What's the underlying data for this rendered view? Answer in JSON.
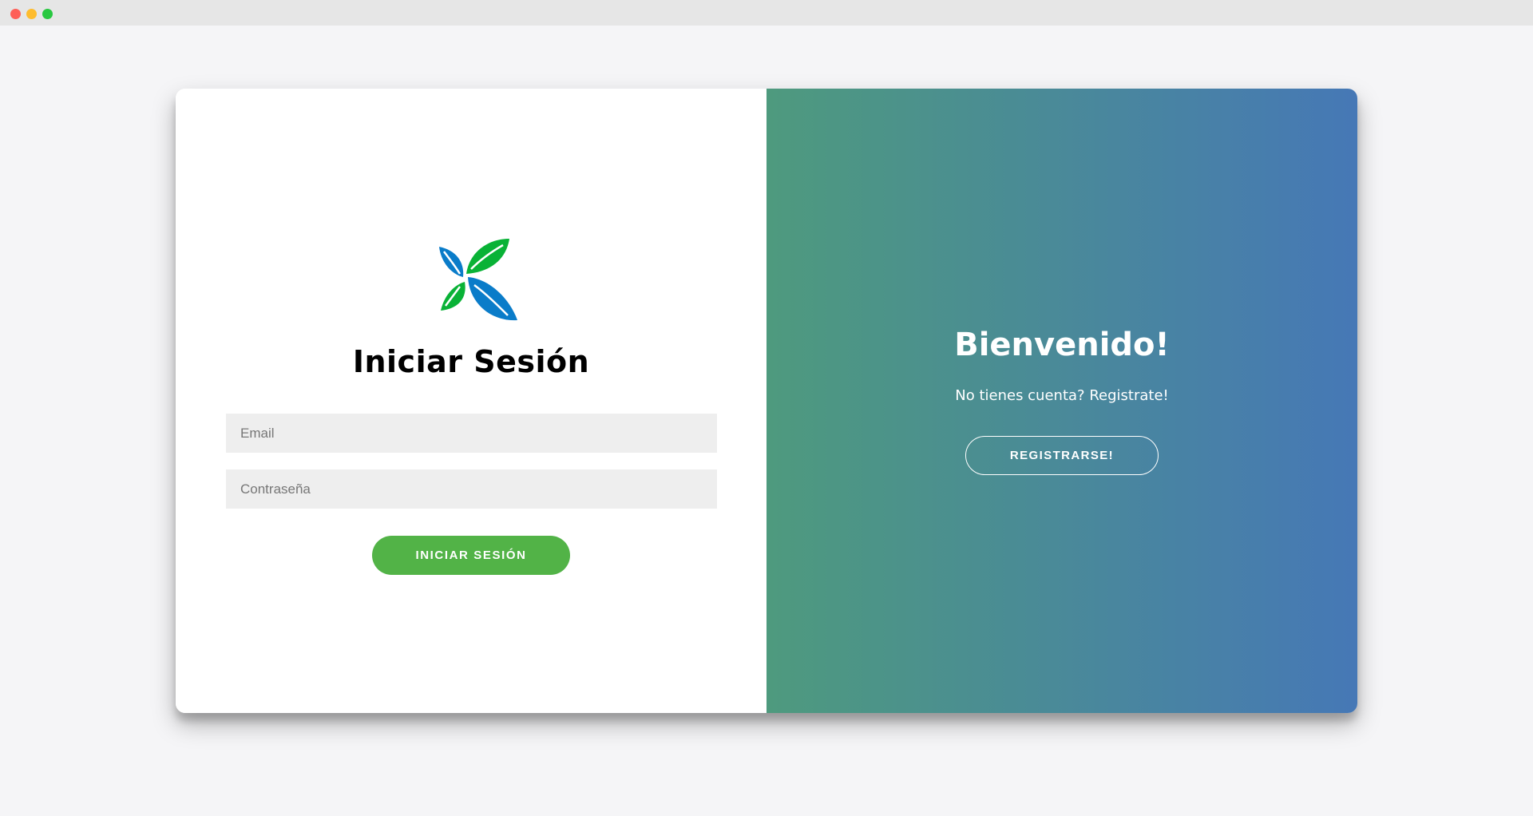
{
  "window": {
    "controls": [
      "close",
      "minimize",
      "maximize"
    ]
  },
  "login": {
    "logo_icon": "leaf-logo-icon",
    "title": "Iniciar Sesión",
    "email_placeholder": "Email",
    "password_placeholder": "Contraseña",
    "submit_label": "INICIAR SESIÓN"
  },
  "welcome": {
    "heading": "Bienvenido!",
    "text": "No tienes cuenta? Registrate!",
    "register_label": "REGISTRARSE!"
  },
  "colors": {
    "login_button": "#52b347",
    "panel_gradient_start": "#4e9a7e",
    "panel_gradient_end": "#4678b6",
    "logo_green": "#09b236",
    "logo_blue": "#0a7cc9"
  }
}
